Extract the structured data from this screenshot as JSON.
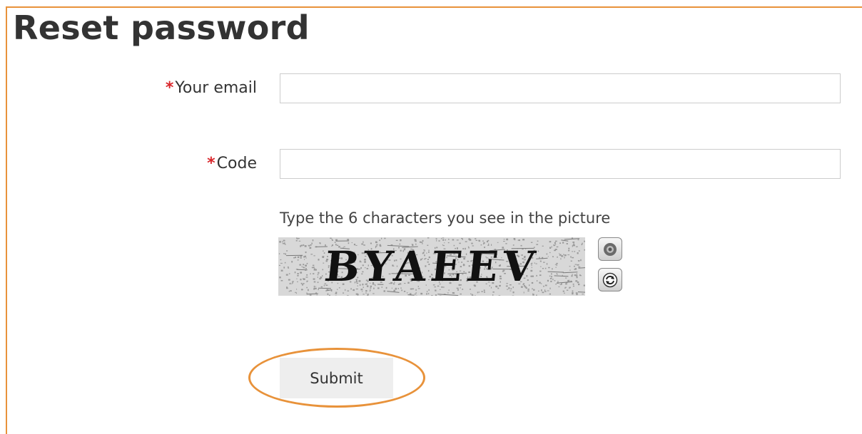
{
  "page": {
    "title": "Reset password"
  },
  "form": {
    "email": {
      "required_marker": "*",
      "label": "Your email",
      "value": "",
      "placeholder": ""
    },
    "code": {
      "required_marker": "*",
      "label": "Code",
      "value": "",
      "placeholder": ""
    },
    "captcha": {
      "hint": "Type the 6 characters you see in the picture",
      "image_text": "BYAEEV",
      "audio_icon": "speaker-icon",
      "refresh_icon": "refresh-icon"
    },
    "submit_label": "Submit"
  },
  "colors": {
    "accent_highlight": "#e8923a",
    "required": "#d9262b",
    "button_bg": "#eeeeee"
  }
}
